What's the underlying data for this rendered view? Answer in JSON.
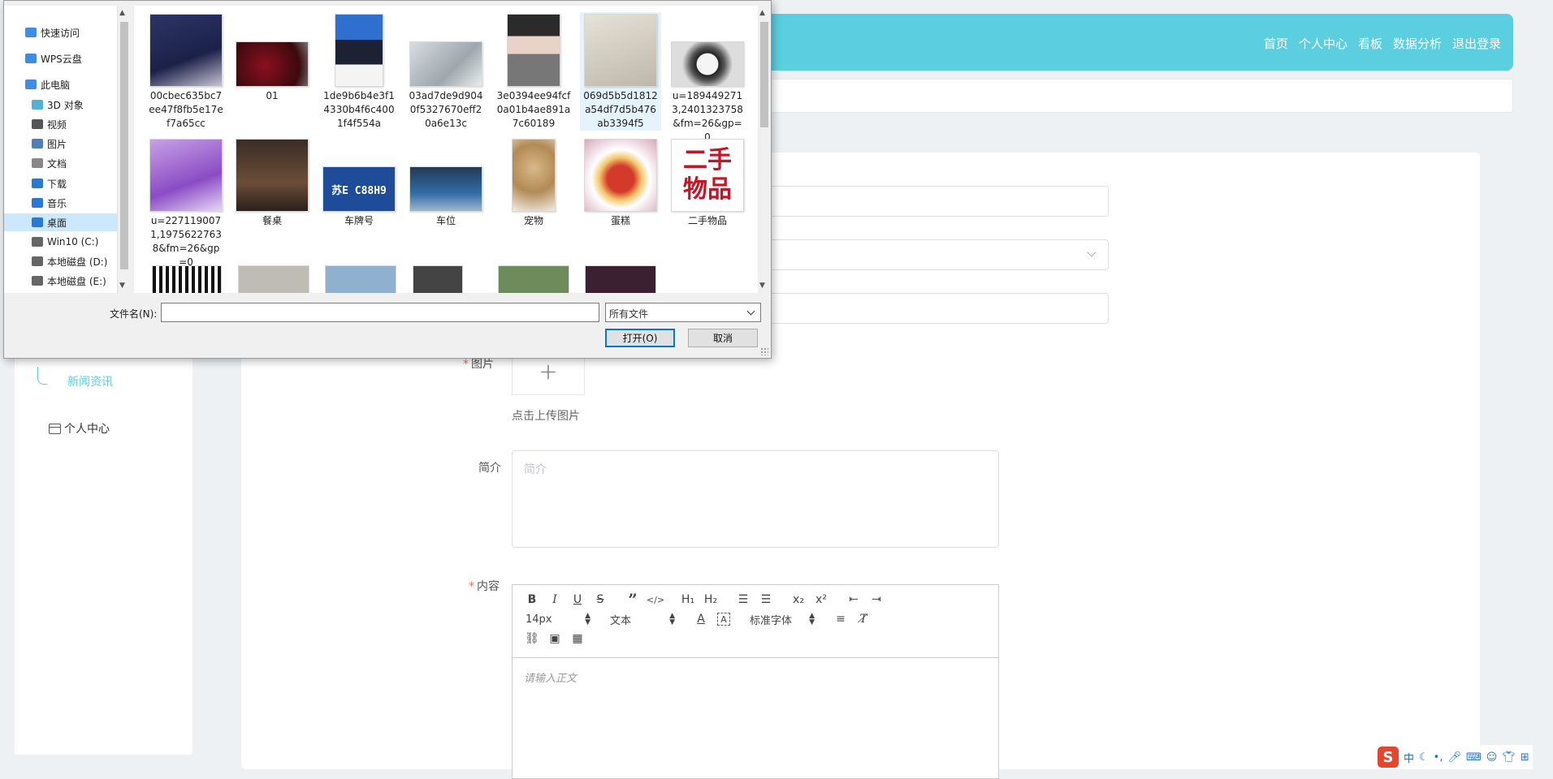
{
  "app": {
    "topnav": [
      "首页",
      "个人中心",
      "看板",
      "数据分析",
      "退出登录"
    ],
    "sidebar": {
      "news": "新闻资讯",
      "personal": "个人中心"
    },
    "form": {
      "image_label": "图片",
      "upload_tip": "点击上传图片",
      "brief_label": "简介",
      "brief_placeholder": "简介",
      "content_label": "内容",
      "content_placeholder": "请输入正文",
      "toolbar": {
        "font_size": "14px",
        "block_type": "文本",
        "font_family": "标准字体"
      }
    }
  },
  "ime": {
    "lang": "中"
  },
  "dialog": {
    "nav": [
      {
        "label": "快速访问",
        "icon": "star-icon"
      },
      {
        "label": "WPS云盘",
        "icon": "cloud-icon"
      },
      {
        "label": "此电脑",
        "icon": "computer-icon"
      },
      {
        "label": "3D 对象",
        "icon": "cube-icon"
      },
      {
        "label": "视频",
        "icon": "video-icon"
      },
      {
        "label": "图片",
        "icon": "picture-icon"
      },
      {
        "label": "文档",
        "icon": "document-icon"
      },
      {
        "label": "下载",
        "icon": "download-icon"
      },
      {
        "label": "音乐",
        "icon": "music-icon"
      },
      {
        "label": "桌面",
        "icon": "desktop-icon",
        "selected": true
      },
      {
        "label": "Win10 (C:)",
        "icon": "drive-icon"
      },
      {
        "label": "本地磁盘 (D:)",
        "icon": "drive-icon"
      },
      {
        "label": "本地磁盘 (E:)",
        "icon": "drive-icon"
      }
    ],
    "files": [
      {
        "name": "00cbec635bc7ee47f8fb5e17ef7a65cc"
      },
      {
        "name": "01"
      },
      {
        "name": "1de9b6b4e3f14330b4f6c4001f4f554a"
      },
      {
        "name": "03ad7de9d9040f5327670eff20a6e13c"
      },
      {
        "name": "3e0394ee94fcf0a01b4ae891a7c60189"
      },
      {
        "name": "069d5b5d1812a54df7d5b476ab3394f5",
        "selected": true
      },
      {
        "name": "u=1894492713,2401323758&fm=26&gp=0"
      },
      {
        "name": "u=2271190071,19756227638&fm=26&gp=0"
      },
      {
        "name": "餐桌"
      },
      {
        "name": "车牌号"
      },
      {
        "name": "车位"
      },
      {
        "name": "宠物"
      },
      {
        "name": "蛋糕"
      },
      {
        "name": "二手物品"
      }
    ],
    "thumb_text": {
      "plate": "苏E C88H9",
      "secondhand": "二手\n物品"
    },
    "filename_label": "文件名(N):",
    "filename_value": "",
    "filetype": "所有文件",
    "open_label": "打开(O)",
    "cancel_label": "取消"
  }
}
